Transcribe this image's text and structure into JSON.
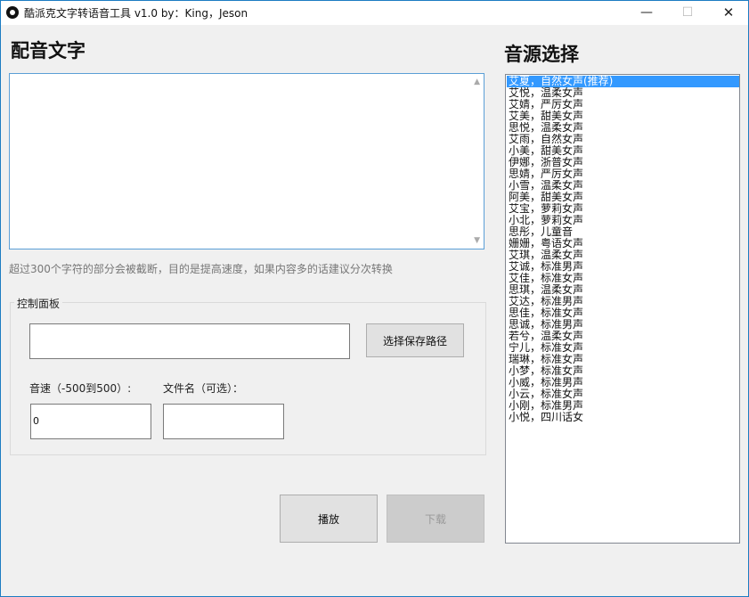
{
  "window": {
    "title": "酷派克文字转语音工具 v1.0 by：King，Jeson",
    "minimize": "—",
    "maximize": "☐",
    "close": "✕"
  },
  "main": {
    "heading": "配音文字",
    "text_value": "",
    "hint": "超过300个字符的部分会被截断，目的是提高速度，如果内容多的话建议分次转换"
  },
  "control_panel": {
    "legend": "控制面板",
    "path_value": "",
    "browse_label": "选择保存路径",
    "speed_label": "音速（-500到500）:",
    "speed_value": "0",
    "filename_label": "文件名（可选）：",
    "filename_value": ""
  },
  "actions": {
    "play_label": "播放",
    "download_label": "下载"
  },
  "voices": {
    "heading": "音源选择",
    "selected_index": 0,
    "items": [
      "艾夏，自然女声(推荐)",
      "艾悦，温柔女声",
      "艾婧，严厉女声",
      "艾美，甜美女声",
      "思悦，温柔女声",
      "艾雨，自然女声",
      "小美，甜美女声",
      "伊娜，浙普女声",
      "思婧，严厉女声",
      "小雪，温柔女声",
      "阿美，甜美女声",
      "艾宝，萝莉女声",
      "小北，萝莉女声",
      "思彤，儿童音",
      "姗姗，粤语女声",
      "艾琪，温柔女声",
      "艾诚，标准男声",
      "艾佳，标准女声",
      "思琪，温柔女声",
      "艾达，标准男声",
      "思佳，标准女声",
      "思诚，标准男声",
      "若兮，温柔女声",
      "宁儿，标准女声",
      "瑞琳，标准女声",
      "小梦，标准女声",
      "小威，标准男声",
      "小云，标准女声",
      "小刚，标准男声",
      "小悦，四川话女"
    ]
  }
}
